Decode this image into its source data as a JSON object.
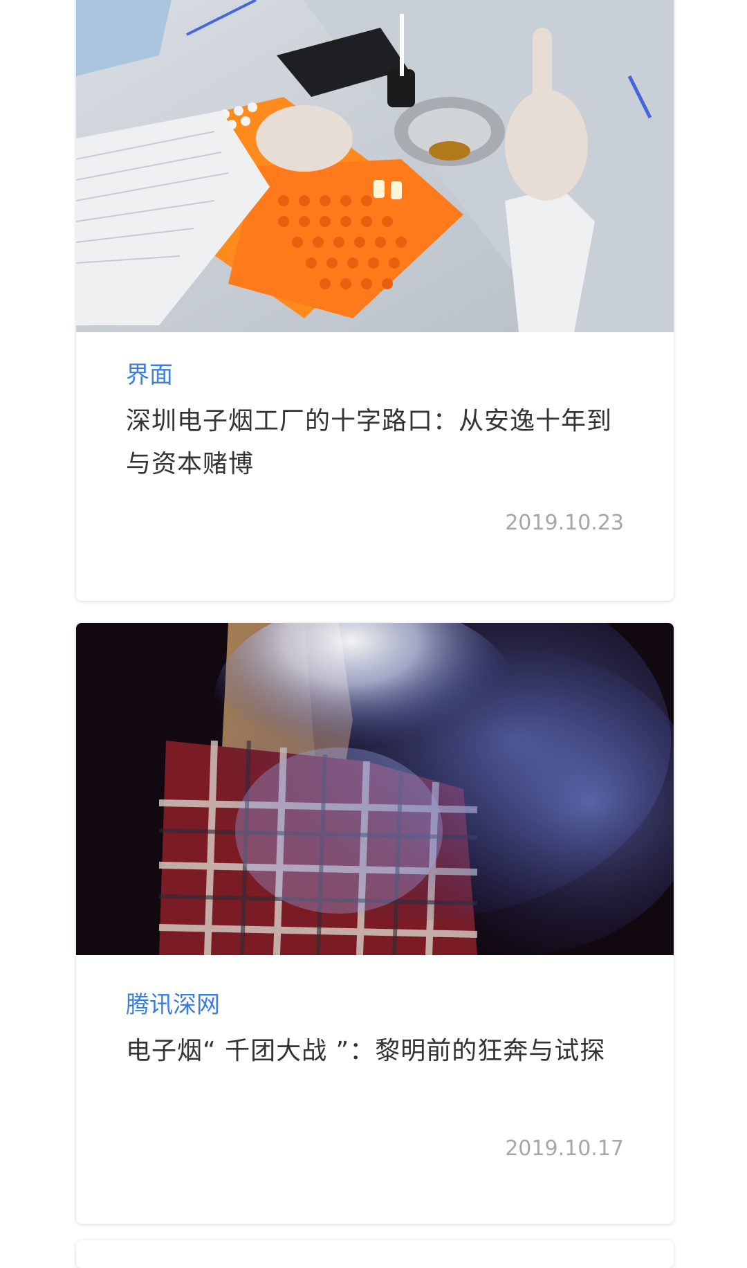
{
  "articles": [
    {
      "source": "界面",
      "title": "深圳电子烟工厂的十字路口：从安逸十年到与资本赌博",
      "date": "2019.10.23",
      "image": "lab-worker-filling-ecig-cartridges"
    },
    {
      "source": "腾讯深网",
      "title": "电子烟“ 千团大战 ”：黎明前的狂奔与试探",
      "date": "2019.10.17",
      "image": "woman-exhaling-vapor-cloud"
    }
  ],
  "colors": {
    "source_accent": "#3b7ddd",
    "title_text": "#333333",
    "date_text": "#a6a6a6"
  }
}
